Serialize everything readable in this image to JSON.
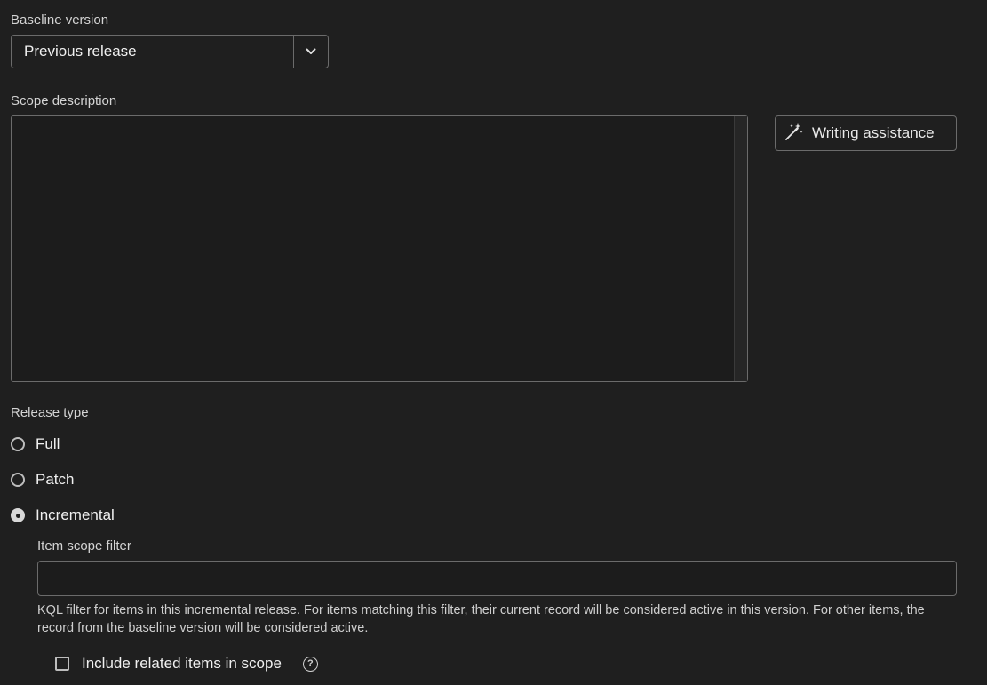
{
  "baseline": {
    "label": "Baseline version",
    "selected": "Previous release",
    "arrow_icon": "chevron-down-icon"
  },
  "scope": {
    "label": "Scope description",
    "value": "",
    "assist_button": {
      "label": "Writing assistance",
      "icon": "magic-wand-icon"
    }
  },
  "release_type": {
    "label": "Release type",
    "options": [
      {
        "label": "Full",
        "checked": false
      },
      {
        "label": "Patch",
        "checked": false
      },
      {
        "label": "Incremental",
        "checked": true
      }
    ]
  },
  "filter": {
    "label": "Item scope filter",
    "value": "",
    "help": "KQL filter for items in this incremental release. For items matching this filter, their current record will be considered active in this version. For other items, the record from the baseline version will be considered active."
  },
  "include_related": {
    "label": "Include related items in scope",
    "checked": false,
    "help_icon": "question-circle-icon"
  }
}
